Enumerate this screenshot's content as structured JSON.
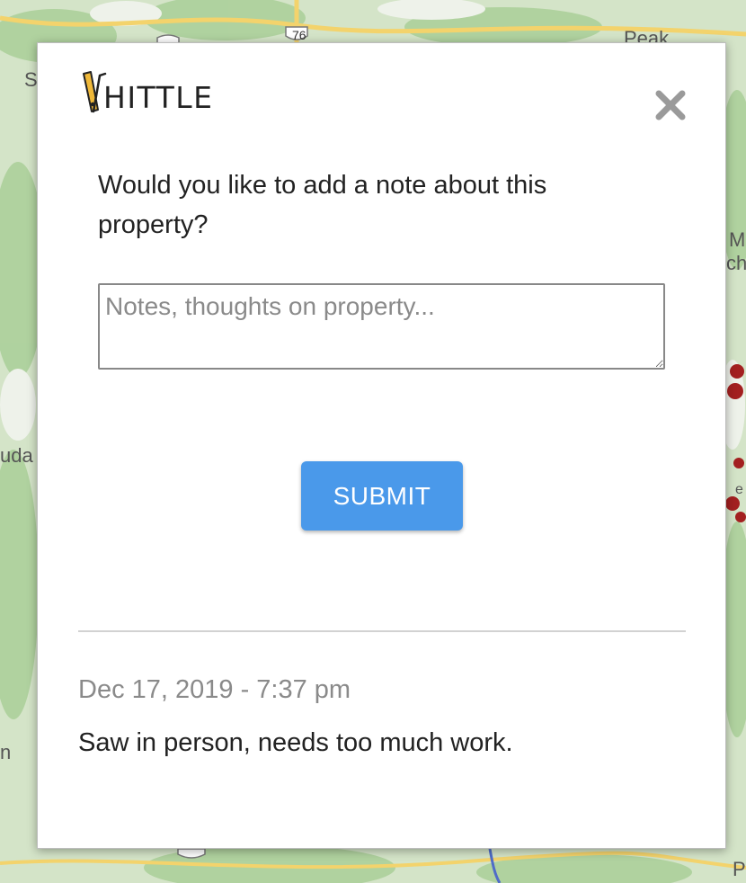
{
  "map": {
    "labels": {
      "highway": "76",
      "peak": "Peak",
      "s": "S",
      "uda": "uda",
      "m": "M",
      "ch": "ch",
      "n": "n",
      "e": "e",
      "p": "P"
    }
  },
  "modal": {
    "logo_text": "HITTLE",
    "question": "Would you like to add a note about this property?",
    "notes_placeholder": "Notes, thoughts on property...",
    "notes_value": "",
    "submit_label": "SUBMIT",
    "accent_color": "#4a99ea",
    "notes": [
      {
        "date": "Dec 17, 2019 - 7:37 pm",
        "text": "Saw in person, needs too much work."
      }
    ]
  }
}
